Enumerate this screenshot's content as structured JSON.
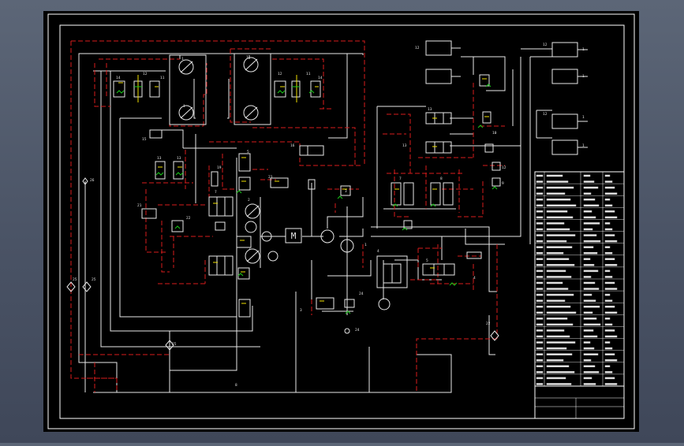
{
  "colors": {
    "background": "#4a5365",
    "paper": "#000000",
    "frame": "#ffffff",
    "pipe_pressure": "#e8e8e8",
    "pipe_pilot": "#d81b1b",
    "valve_accent": "#f0e000",
    "spring": "#19c819",
    "table_text": "#ffffff"
  },
  "drawing": {
    "title": "",
    "title_block": {
      "label_cell": "",
      "status_cell": ""
    }
  },
  "components": {
    "motor_label": "M"
  },
  "table_rows": 18,
  "icons": [
    "motor-symbol",
    "pump-symbol",
    "check-valve-symbol",
    "directional-valve-symbol",
    "cylinder-symbol",
    "accumulator-symbol",
    "filter-symbol"
  ]
}
